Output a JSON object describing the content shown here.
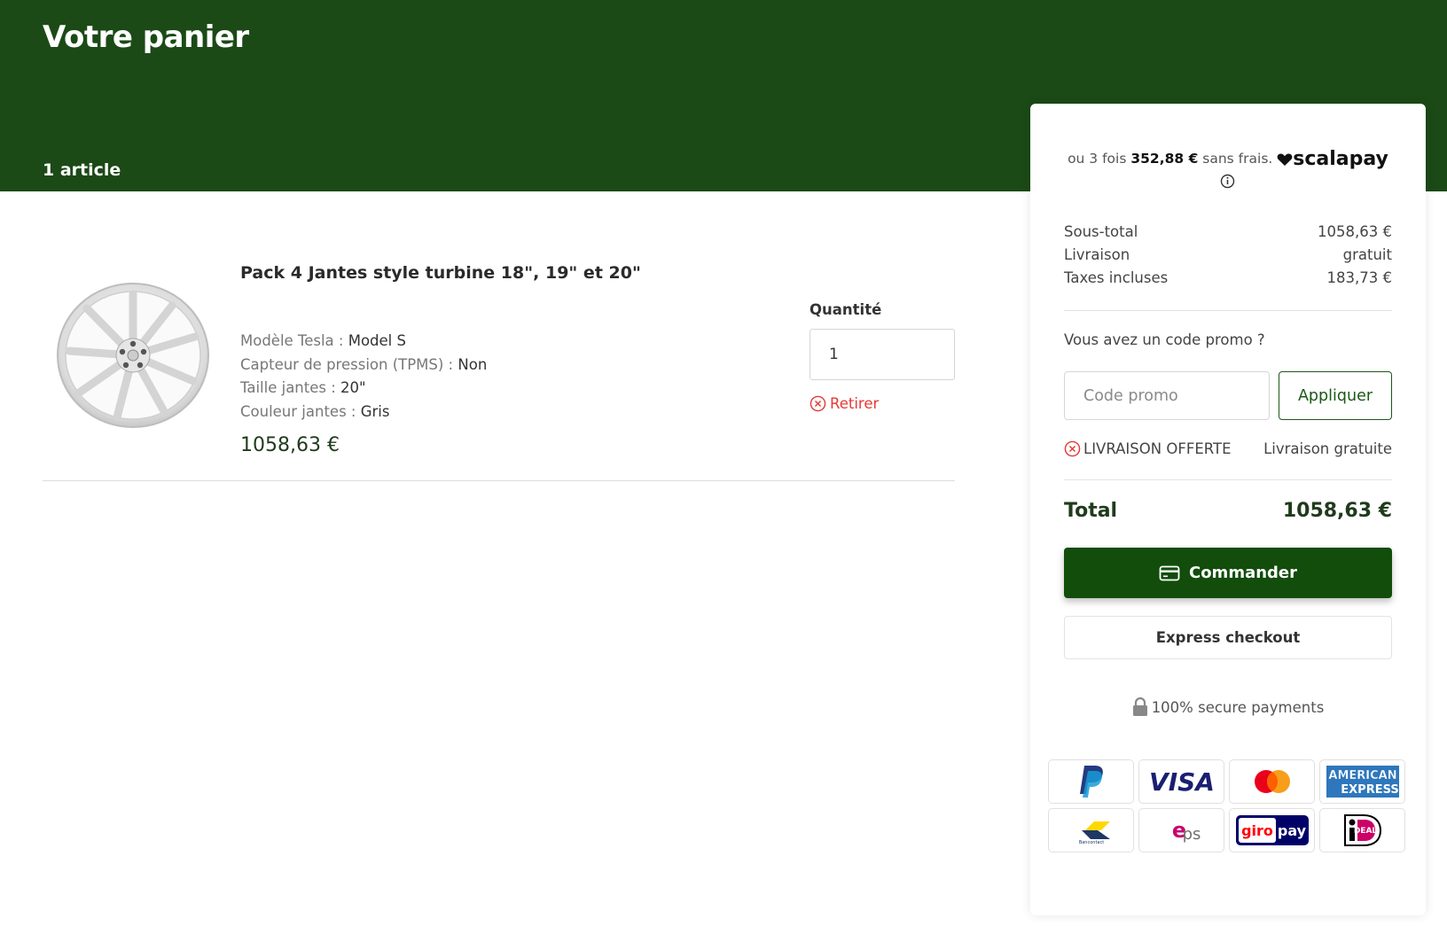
{
  "header": {
    "title": "Votre panier",
    "item_count": "1 article",
    "background_color": "#1b4a16"
  },
  "cart_item": {
    "title": "Pack 4 Jantes style turbine 18\", 19\" et 20\"",
    "image": "alloy-wheel-silver",
    "attributes": [
      {
        "key": "Modèle Tesla : ",
        "value": "Model S"
      },
      {
        "key": "Capteur de pression (TPMS) : ",
        "value": "Non"
      },
      {
        "key": "Taille jantes : ",
        "value": "20\""
      },
      {
        "key": "Couleur jantes : ",
        "value": "Gris"
      }
    ],
    "price": "1058,63 €",
    "quantity_label": "Quantité",
    "quantity": "1",
    "remove_label": "Retirer"
  },
  "summary": {
    "scalapay": {
      "prefix": "ou 3 fois ",
      "amount": "352,88 €",
      "suffix": " sans frais.",
      "brand": "scalapay"
    },
    "subtotal": {
      "label": "Sous-total",
      "value": "1058,63 €"
    },
    "shipping": {
      "label": "Livraison",
      "value": "gratuit"
    },
    "taxes": {
      "label": "Taxes incluses",
      "value": "183,73 €"
    },
    "promo": {
      "question": "Vous avez un code promo ?",
      "placeholder": "Code promo",
      "apply_label": "Appliquer"
    },
    "discount": {
      "name": "LIVRAISON OFFERTE",
      "value": "Livraison gratuite"
    },
    "total": {
      "label": "Total",
      "value": "1058,63 €"
    },
    "order_label": "Commander",
    "express_label": "Express checkout",
    "secure_label": "100% secure payments",
    "payment_methods": [
      "paypal",
      "visa",
      "mastercard",
      "american-express",
      "bancontact",
      "eps",
      "giropay",
      "ideal"
    ],
    "accent_color": "#124d0c"
  }
}
